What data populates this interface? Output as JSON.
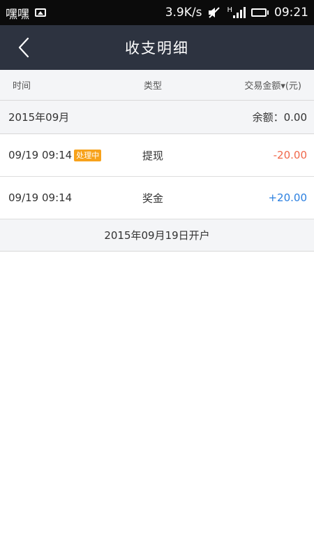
{
  "status_bar": {
    "carrier": "嘿嘿",
    "speed": "3.9K/s",
    "network_type": "H",
    "time": "09:21",
    "icons": [
      "image-icon",
      "mute-icon",
      "signal-icon",
      "battery-icon"
    ],
    "battery_color": "#35d22e"
  },
  "nav": {
    "title": "收支明细",
    "back_icon": "chevron-left-icon"
  },
  "columns": {
    "time": "时间",
    "type": "类型",
    "amount": "交易金额▾(元)"
  },
  "month": {
    "label": "2015年09月",
    "balance_label": "余额：",
    "balance": "0.00"
  },
  "transactions": [
    {
      "time": "09/19 09:14",
      "badge": "处理中",
      "type": "提现",
      "amount": "-20.00",
      "amount_color": "#f0674a"
    },
    {
      "time": "09/19 09:14",
      "badge": "",
      "type": "奖金",
      "amount": "+20.00",
      "amount_color": "#2a7fe0"
    }
  ],
  "footer": {
    "text": "2015年09月19日开户"
  }
}
